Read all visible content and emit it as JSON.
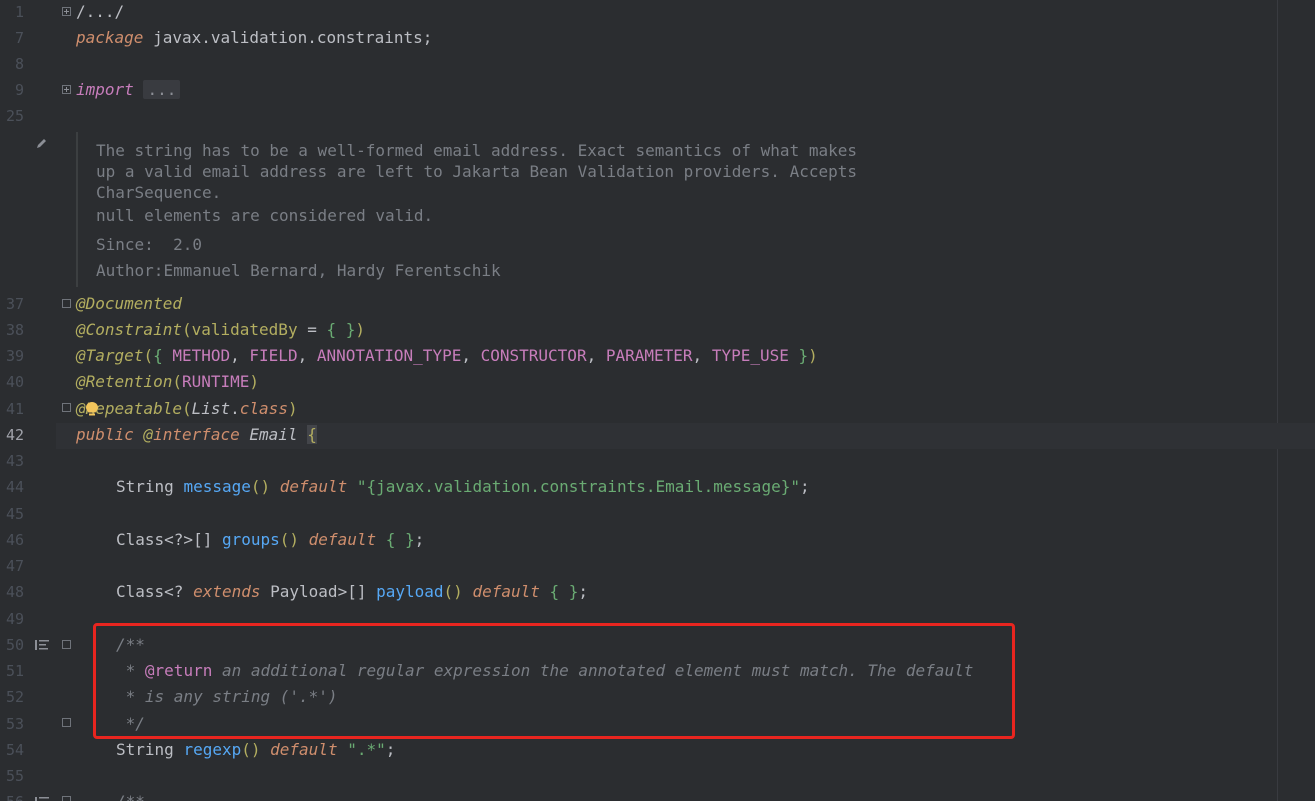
{
  "gutter": {
    "lines": [
      "1",
      "7",
      "8",
      "9",
      "25",
      "37",
      "38",
      "39",
      "40",
      "41",
      "42",
      "43",
      "44",
      "45",
      "46",
      "47",
      "48",
      "49",
      "50",
      "51",
      "52",
      "53",
      "54",
      "55",
      "56"
    ]
  },
  "code": {
    "header_fold": "/.../",
    "package_kw": "package",
    "package_name": " javax.validation.constraints;",
    "import_kw": "import",
    "import_collapsed": "...",
    "doc": {
      "line1": "The string has to be a well-formed email address. Exact semantics of what makes",
      "line2": "up a valid email address are left to Jakarta Bean Validation providers. Accepts",
      "line3": "CharSequence.",
      "line4": "null elements are considered valid.",
      "since_label": "Since:",
      "since_value": "2.0",
      "author_label": "Author:",
      "author_value": "Emmanuel Bernard, Hardy Ferentschik"
    },
    "ann_documented": "@Documented",
    "ann_constraint": "@Constraint",
    "constraint_args_open": "(",
    "constraint_param": "validatedBy",
    "constraint_eq": " = ",
    "constraint_braces": "{ }",
    "constraint_close": ")",
    "ann_target": "@Target",
    "target_open": "(",
    "target_brace_open": "{ ",
    "target_values": [
      "METHOD",
      "FIELD",
      "ANNOTATION_TYPE",
      "CONSTRUCTOR",
      "PARAMETER",
      "TYPE_USE"
    ],
    "target_brace_close": " }",
    "target_close": ")",
    "ann_retention": "@Retention",
    "retention_open": "(",
    "retention_value": "RUNTIME",
    "retention_close": ")",
    "ann_repeatable_at": "@",
    "ann_repeatable": "Repeatable",
    "repeatable_open": "(",
    "repeatable_type": "List",
    "repeatable_dot": ".",
    "repeatable_class": "class",
    "repeatable_close": ")",
    "public_kw": "public",
    "interface_at": " @",
    "interface_kw": "interface",
    "interface_name": " Email ",
    "interface_brace": "{",
    "message_type": "String ",
    "message_name": "message",
    "message_parens": "()",
    "default_kw": "default",
    "message_value": "\"{javax.validation.constraints.Email.message}\"",
    "semicolon": ";",
    "groups_type": "Class<?>[] ",
    "groups_name": "groups",
    "groups_parens": "()",
    "groups_value": "{ }",
    "payload_type1": "Class<? ",
    "extends_kw": "extends",
    "payload_type2": " Payload>[] ",
    "payload_name": "payload",
    "payload_parens": "()",
    "payload_value": "{ }",
    "javadoc_open": "/**",
    "javadoc_star": " * ",
    "return_tag": "@return",
    "return_text": " an additional regular expression the annotated element must match. The default",
    "javadoc_line2": " * is any string ('.*')",
    "javadoc_close": " */",
    "regexp_type": "String ",
    "regexp_name": "regexp",
    "regexp_parens": "()",
    "regexp_value": "\".*\"",
    "next_javadoc": "/**"
  },
  "colors": {
    "background": "#2b2d30",
    "keyword": "#cf8e6d",
    "annotation": "#b3ae60",
    "constant": "#c77dbb",
    "method": "#56a8f5",
    "string": "#6aab73",
    "comment": "#7a7e85",
    "highlight_box": "#e8251f"
  }
}
